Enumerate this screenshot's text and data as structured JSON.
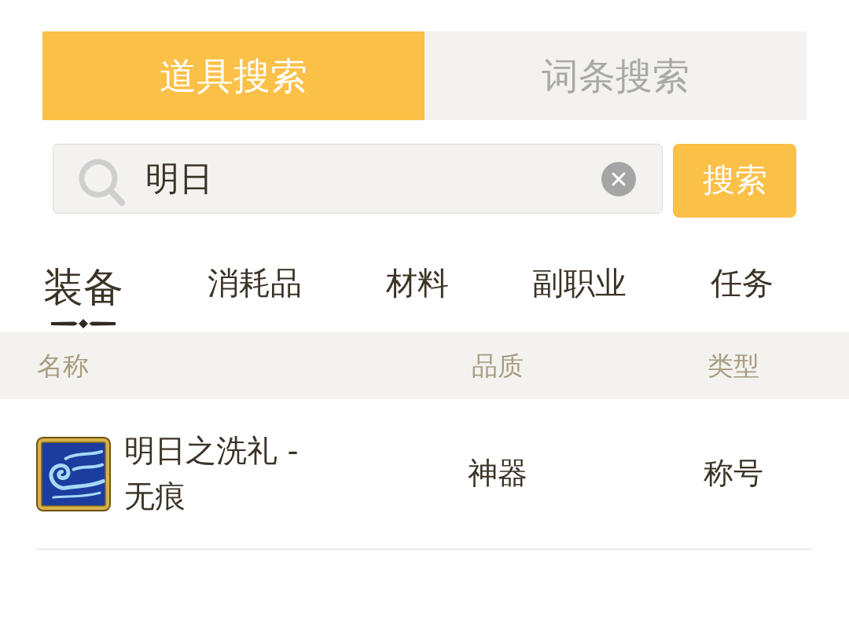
{
  "search_tabs": [
    {
      "label": "道具搜索",
      "selected": true
    },
    {
      "label": "词条搜索",
      "selected": false
    }
  ],
  "search": {
    "value": "明日",
    "button": "搜索"
  },
  "category_tabs": [
    {
      "label": "装备",
      "selected": true
    },
    {
      "label": "消耗品",
      "selected": false
    },
    {
      "label": "材料",
      "selected": false
    },
    {
      "label": "副职业",
      "selected": false
    },
    {
      "label": "任务",
      "selected": false
    }
  ],
  "table": {
    "columns": [
      "名称",
      "品质",
      "类型"
    ],
    "rows": [
      {
        "name": "明日之洗礼 - 无痕",
        "quality": "神器",
        "type": "称号"
      }
    ]
  }
}
